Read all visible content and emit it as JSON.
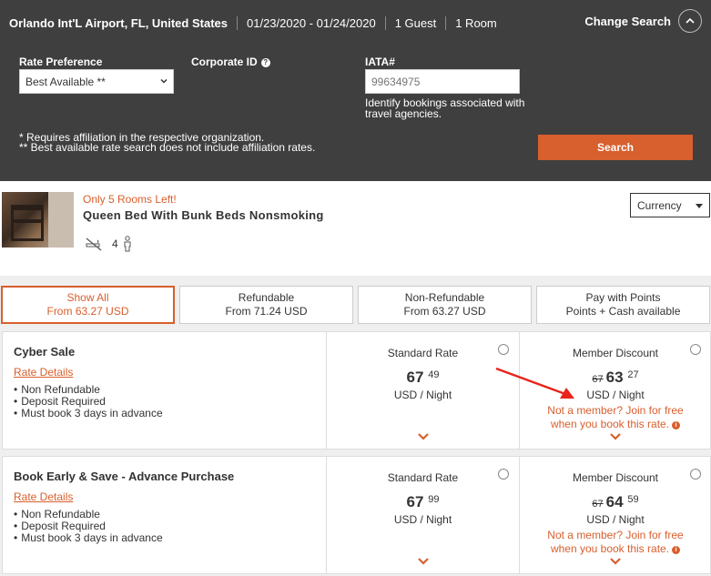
{
  "search": {
    "location": "Orlando Int'L Airport, FL, United States",
    "dates": "01/23/2020 - 01/24/2020",
    "guests": "1 Guest",
    "rooms": "1 Room",
    "change_label": "Change Search",
    "rate_pref_label": "Rate Preference",
    "rate_pref_value": "Best Available **",
    "corporate_label": "Corporate ID",
    "iata_label": "IATA#",
    "iata_placeholder": "99634975",
    "iata_help": "Identify bookings associated with travel agencies.",
    "note1": "* Requires affiliation in the respective organization.",
    "note2": "** Best available rate search does not include affiliation rates.",
    "search_button": "Search"
  },
  "room": {
    "availability": "Only 5 Rooms Left!",
    "name": "Queen Bed With Bunk Beds Nonsmoking",
    "occupancy": "4",
    "currency_label": "Currency"
  },
  "tabs": [
    {
      "label": "Show All",
      "sub": "From 63.27 USD"
    },
    {
      "label": "Refundable",
      "sub": "From 71.24 USD"
    },
    {
      "label": "Non-Refundable",
      "sub": "From 63.27 USD"
    },
    {
      "label": "Pay with Points",
      "sub_bold": "Points + Cash",
      "sub_rest": " available"
    }
  ],
  "rates": [
    {
      "title": "Cyber Sale",
      "details_label": "Rate Details",
      "terms": [
        "Non Refundable",
        "Deposit Required",
        "Must book 3 days in advance"
      ],
      "standard": {
        "title": "Standard Rate",
        "whole": "67",
        "cents": "49",
        "unit": "USD / Night"
      },
      "member": {
        "title": "Member Discount",
        "was": "67",
        "whole": "63",
        "cents": "27",
        "unit": "USD / Night",
        "promo1": "Not a member? Join for free",
        "promo2": "when you book this rate."
      }
    },
    {
      "title": "Book Early & Save - Advance Purchase",
      "details_label": "Rate Details",
      "terms": [
        "Non Refundable",
        "Deposit Required",
        "Must book 3 days in advance"
      ],
      "standard": {
        "title": "Standard Rate",
        "whole": "67",
        "cents": "99",
        "unit": "USD / Night"
      },
      "member": {
        "title": "Member Discount",
        "was": "67",
        "whole": "64",
        "cents": "59",
        "unit": "USD / Night",
        "promo1": "Not a member? Join for free",
        "promo2": "when you book this rate."
      }
    }
  ],
  "colors": {
    "accent": "#d85f2e",
    "panel": "#3f3f3f",
    "annotation": "#e8241b"
  }
}
